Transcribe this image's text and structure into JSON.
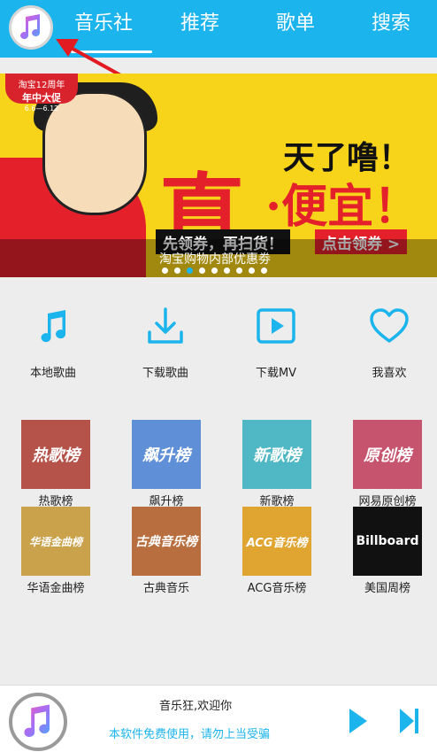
{
  "header": {
    "tabs": [
      {
        "label": "音乐社"
      },
      {
        "label": "推荐"
      },
      {
        "label": "歌单"
      },
      {
        "label": "搜索"
      }
    ],
    "active_tab": "音乐社",
    "accent_color": "#1cb4ec"
  },
  "banner": {
    "badge_line1": "淘宝12周年",
    "badge_line2": "年中大促",
    "badge_line3": "6.6—6.12",
    "big_char": "真",
    "headline1": "天了噜！",
    "headline2": "·便宜！",
    "slogan": "先领券，再扫货！",
    "cta": "点击领券 >",
    "caption": "淘宝购物内部优惠劵",
    "dot_count": 9,
    "active_dot": 2
  },
  "quick_actions": [
    {
      "label": "本地歌曲",
      "icon": "music-note-icon"
    },
    {
      "label": "下载歌曲",
      "icon": "download-icon"
    },
    {
      "label": "下载MV",
      "icon": "video-play-icon"
    },
    {
      "label": "我喜欢",
      "icon": "heart-icon"
    }
  ],
  "charts": [
    {
      "label": "热歌榜",
      "tile_text": "热歌榜",
      "color": "#b5534a"
    },
    {
      "label": "飙升榜",
      "tile_text": "飙升榜",
      "color": "#5f8fd6"
    },
    {
      "label": "新歌榜",
      "tile_text": "新歌榜",
      "color": "#4fb8c4"
    },
    {
      "label": "网易原创榜",
      "tile_text": "原创榜",
      "color": "#c7546f"
    },
    {
      "label": "华语金曲榜",
      "tile_text": "华语金曲榜",
      "color": "#c9a24b"
    },
    {
      "label": "古典音乐",
      "tile_text": "古典音乐榜",
      "color": "#b86e3e"
    },
    {
      "label": "ACG音乐榜",
      "tile_text": "ACG音乐榜",
      "color": "#e0a531"
    },
    {
      "label": "美国周榜",
      "tile_text": "Billboard",
      "color": "#111111"
    }
  ],
  "player": {
    "title": "音乐狂,欢迎你",
    "subtitle": "本软件免费使用，请勿上当受骗"
  }
}
